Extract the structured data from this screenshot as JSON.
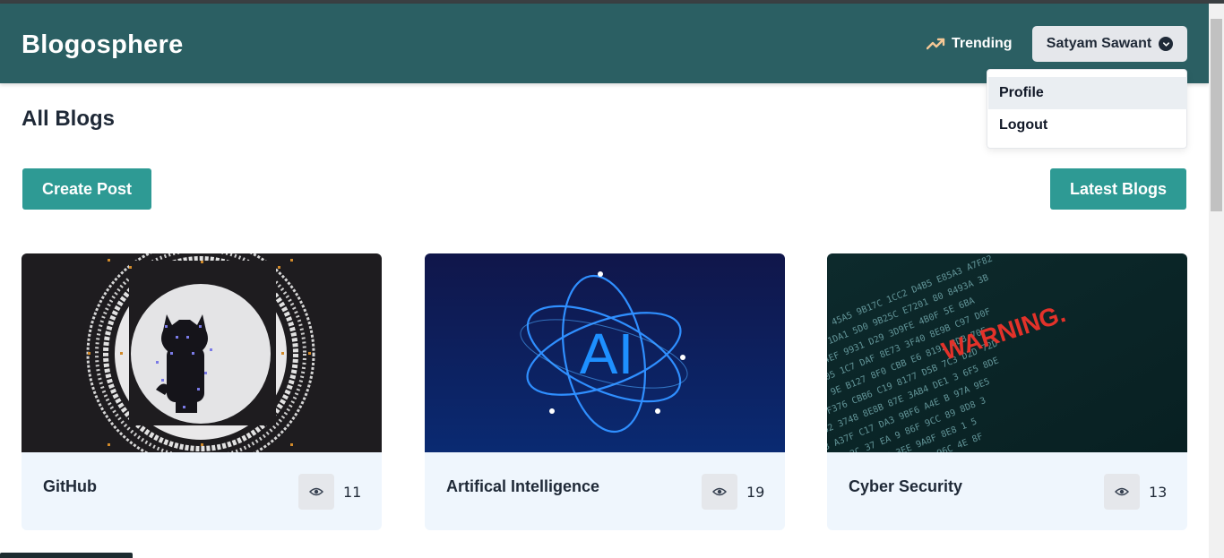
{
  "app": {
    "brand": "Blogosphere"
  },
  "nav": {
    "trending_label": "Trending",
    "trending_icon": "trending-up-icon",
    "user_name": "Satyam Sawant",
    "user_menu_icon": "chevron-down-circle-icon"
  },
  "dropdown": {
    "items": [
      "Profile",
      "Logout"
    ]
  },
  "page": {
    "title": "All Blogs"
  },
  "actions": {
    "create": "Create Post",
    "latest": "Latest Blogs"
  },
  "posts": [
    {
      "title": "GitHub",
      "views": "11",
      "image": "github-octocat-logo"
    },
    {
      "title": "Artifical Intelligence",
      "views": "19",
      "image": "ai-atom-illustration"
    },
    {
      "title": "Cyber Security",
      "views": "13",
      "image": "warning-hex-code-screen"
    }
  ],
  "colors": {
    "navbar": "#2b5f63",
    "accent": "#2e9a94",
    "card_bg": "#eff6fd"
  }
}
